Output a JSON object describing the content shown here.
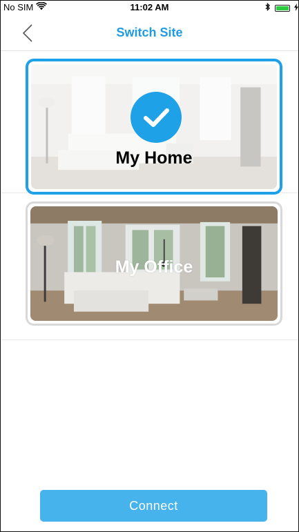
{
  "status_bar": {
    "carrier": "No SIM",
    "time": "11:02 AM",
    "wifi_icon": "wifi-icon",
    "bluetooth_icon": "bluetooth-icon",
    "battery_level": 1.0,
    "charging_icon": "charging-bolt-icon"
  },
  "nav": {
    "title": "Switch Site",
    "back_icon": "chevron-left-icon"
  },
  "sites": [
    {
      "label": "My Home",
      "selected": true
    },
    {
      "label": "My Office",
      "selected": false
    }
  ],
  "actions": {
    "connect_label": "Connect"
  },
  "colors": {
    "accent": "#1ea1e6",
    "button": "#47b3ec",
    "battery": "#2ecc40"
  }
}
